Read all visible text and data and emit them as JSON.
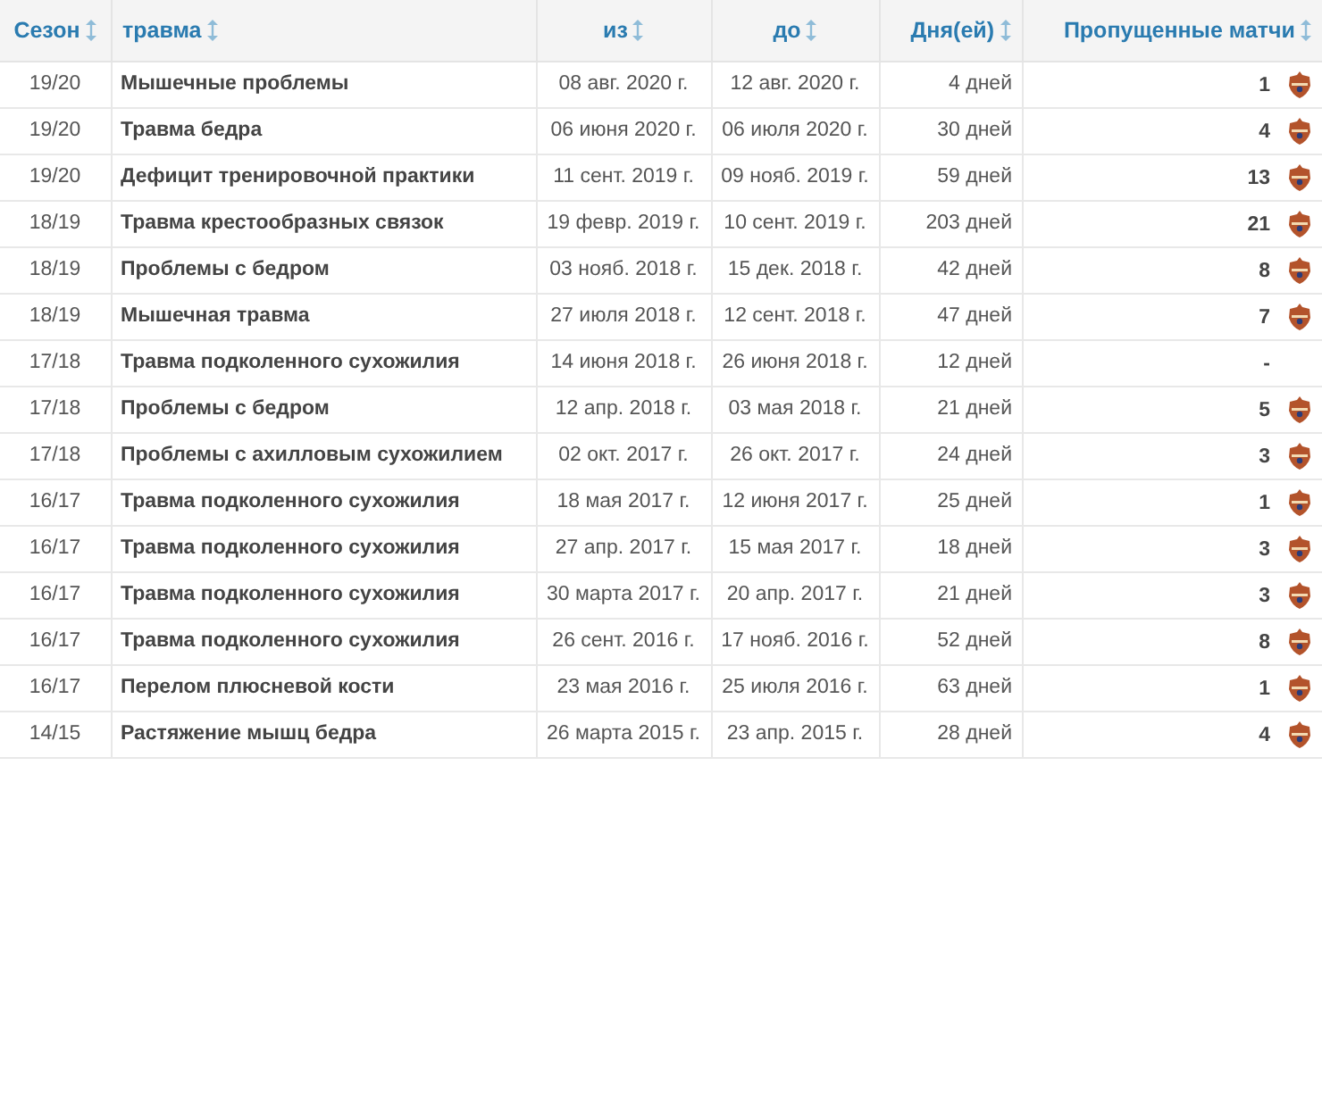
{
  "table": {
    "columns": [
      "Сезон",
      "травма",
      "из",
      "до",
      "Дня(ей)",
      "Пропущенные матчи"
    ],
    "rows": [
      {
        "season": "19/20",
        "injury": "Мышечные проблемы",
        "from": "08 авг. 2020 г.",
        "until": "12 авг. 2020 г.",
        "days": "4 дней",
        "missed": "1",
        "crest": true
      },
      {
        "season": "19/20",
        "injury": "Травма бедра",
        "from": "06 июня 2020 г.",
        "until": "06 июля 2020 г.",
        "days": "30 дней",
        "missed": "4",
        "crest": true
      },
      {
        "season": "19/20",
        "injury": "Дефицит тренировочной практики",
        "from": "11 сент. 2019 г.",
        "until": "09 нояб. 2019 г.",
        "days": "59 дней",
        "missed": "13",
        "crest": true
      },
      {
        "season": "18/19",
        "injury": "Травма крестообразных связок",
        "from": "19 февр. 2019 г.",
        "until": "10 сент. 2019 г.",
        "days": "203 дней",
        "missed": "21",
        "crest": true
      },
      {
        "season": "18/19",
        "injury": "Проблемы с бедром",
        "from": "03 нояб. 2018 г.",
        "until": "15 дек. 2018 г.",
        "days": "42 дней",
        "missed": "8",
        "crest": true
      },
      {
        "season": "18/19",
        "injury": "Мышечная травма",
        "from": "27 июля 2018 г.",
        "until": "12 сент. 2018 г.",
        "days": "47 дней",
        "missed": "7",
        "crest": true
      },
      {
        "season": "17/18",
        "injury": "Травма подколенного сухожилия",
        "from": "14 июня 2018 г.",
        "until": "26 июня 2018 г.",
        "days": "12 дней",
        "missed": "-",
        "crest": false
      },
      {
        "season": "17/18",
        "injury": "Проблемы с бедром",
        "from": "12 апр. 2018 г.",
        "until": "03 мая 2018 г.",
        "days": "21 дней",
        "missed": "5",
        "crest": true
      },
      {
        "season": "17/18",
        "injury": "Проблемы с ахилловым сухожилием",
        "from": "02 окт. 2017 г.",
        "until": "26 окт. 2017 г.",
        "days": "24 дней",
        "missed": "3",
        "crest": true
      },
      {
        "season": "16/17",
        "injury": "Травма подколенного сухожилия",
        "from": "18 мая 2017 г.",
        "until": "12 июня 2017 г.",
        "days": "25 дней",
        "missed": "1",
        "crest": true
      },
      {
        "season": "16/17",
        "injury": "Травма подколенного сухожилия",
        "from": "27 апр. 2017 г.",
        "until": "15 мая 2017 г.",
        "days": "18 дней",
        "missed": "3",
        "crest": true
      },
      {
        "season": "16/17",
        "injury": "Травма подколенного сухожилия",
        "from": "30 марта 2017 г.",
        "until": "20 апр. 2017 г.",
        "days": "21 дней",
        "missed": "3",
        "crest": true
      },
      {
        "season": "16/17",
        "injury": "Травма подколенного сухожилия",
        "from": "26 сент. 2016 г.",
        "until": "17 нояб. 2016 г.",
        "days": "52 дней",
        "missed": "8",
        "crest": true
      },
      {
        "season": "16/17",
        "injury": "Перелом плюсневой кости",
        "from": "23 мая 2016 г.",
        "until": "25 июля 2016 г.",
        "days": "63 дней",
        "missed": "1",
        "crest": true
      },
      {
        "season": "14/15",
        "injury": "Растяжение мышц бедра",
        "from": "26 марта 2015 г.",
        "until": "23 апр. 2015 г.",
        "days": "28 дней",
        "missed": "4",
        "crest": true
      }
    ]
  }
}
